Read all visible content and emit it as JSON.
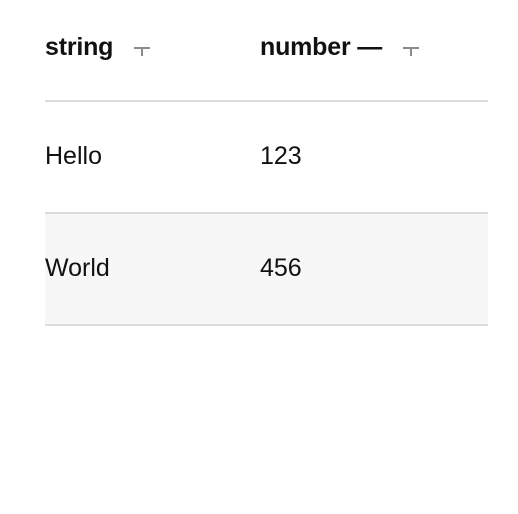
{
  "table": {
    "columns": [
      {
        "label": "string",
        "filter_icon": "filter-icon"
      },
      {
        "label": "number —",
        "filter_icon": "filter-icon"
      }
    ],
    "rows": [
      [
        "Hello",
        "123"
      ],
      [
        "World",
        "456"
      ]
    ],
    "colors": {
      "divider": "#dcdcdc",
      "alt_row_background": "#f7f7f7",
      "icon": "#8a8a8a"
    }
  }
}
